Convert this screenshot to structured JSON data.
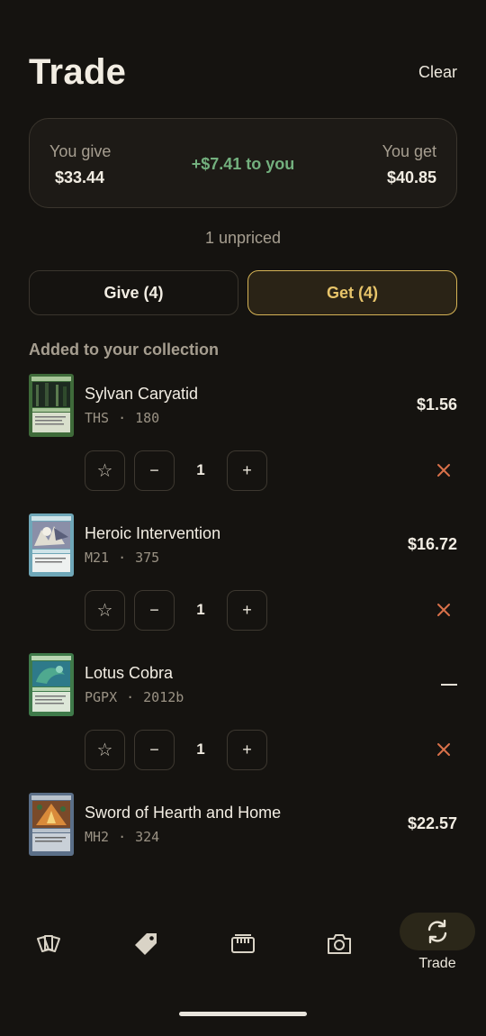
{
  "header": {
    "title": "Trade",
    "clear_label": "Clear"
  },
  "summary": {
    "give_label": "You give",
    "give_value": "$33.44",
    "diff": "+$7.41 to you",
    "get_label": "You get",
    "get_value": "$40.85"
  },
  "unpriced": "1 unpriced",
  "tabs": [
    {
      "label": "Give (4)",
      "active": false
    },
    {
      "label": "Get (4)",
      "active": true
    }
  ],
  "section_title": "Added to your collection",
  "cards": [
    {
      "name": "Sylvan Caryatid",
      "set": "THS",
      "number": "180",
      "price": "$1.56",
      "quantity": "1"
    },
    {
      "name": "Heroic Intervention",
      "set": "M21",
      "number": "375",
      "price": "$16.72",
      "quantity": "1"
    },
    {
      "name": "Lotus Cobra",
      "set": "PGPX",
      "number": "2012b",
      "price": "—",
      "quantity": "1"
    },
    {
      "name": "Sword of Hearth and Home",
      "set": "MH2",
      "number": "324",
      "price": "$22.57"
    }
  ],
  "controls": {
    "star_glyph": "☆",
    "minus_glyph": "−",
    "plus_glyph": "+",
    "dot": "·"
  },
  "nav": {
    "items": [
      "collection-icon",
      "price-tag-icon",
      "binder-icon",
      "camera-icon",
      "trade-icon"
    ],
    "active_label": "Trade"
  },
  "colors": {
    "background": "#151310",
    "accent": "#d6b456",
    "positive": "#73b07e",
    "remove": "#d9714a"
  }
}
